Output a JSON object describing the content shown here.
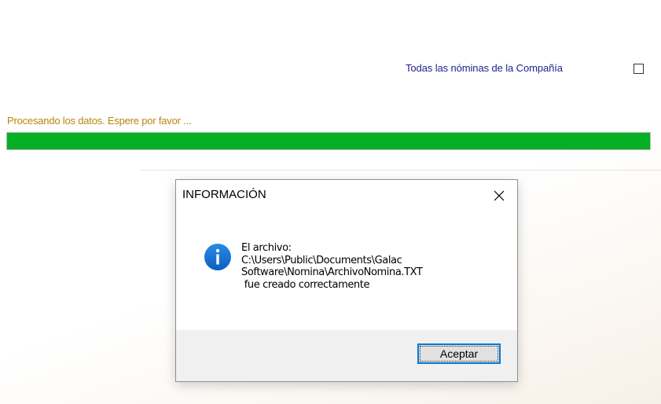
{
  "form": {
    "company_checkbox_label": "Todas las nóminas de la Compañía",
    "company_checkbox_checked": false
  },
  "progress": {
    "status_text": "Procesando los datos.  Espere por favor ...",
    "fraction": 1.0,
    "fill_color": "#06b025"
  },
  "dialog": {
    "title": "INFORMACIÓN",
    "icon": "info-icon",
    "message": "El archivo:\nC:\\Users\\Public\\Documents\\Galac\nSoftware\\Nomina\\ArchivoNomina.TXT\n fue creado correctamente",
    "ok_label": "Aceptar",
    "close_icon": "close-icon"
  },
  "colors": {
    "label_blue": "#1f1f8f",
    "status_gold": "#b8860b",
    "accent": "#0078d7",
    "info_icon": "#0a6fd1"
  }
}
